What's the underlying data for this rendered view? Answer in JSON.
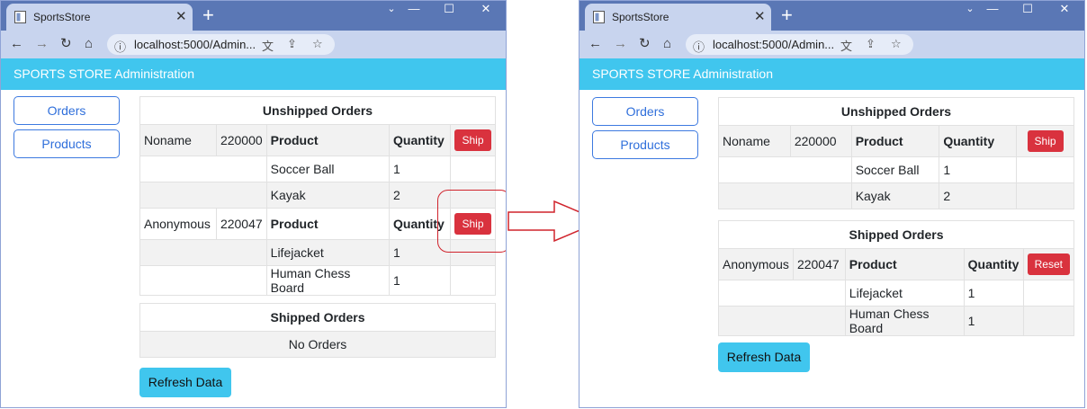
{
  "browser": {
    "tab_title": "SportsStore",
    "address": "localhost:5000/Admin...",
    "icons": [
      "back-arrow-icon",
      "forward-arrow-icon",
      "reload-icon",
      "home-icon",
      "info-icon",
      "translate-icon",
      "share-icon",
      "star-icon",
      "close-icon",
      "plus-icon",
      "minimize-icon",
      "maximize-icon"
    ]
  },
  "app": {
    "banner": "SPORTS STORE Administration",
    "nav": {
      "orders": "Orders",
      "products": "Products"
    },
    "refresh": "Refresh Data",
    "colors": {
      "banner": "#40c6ee",
      "danger": "#d9323e",
      "primary_outline": "#3d7ae0"
    }
  },
  "before": {
    "unshipped": {
      "title": "Unshipped Orders",
      "orders": [
        {
          "name": "Noname",
          "number": "220000",
          "product_header": "Product",
          "quantity_header": "Quantity",
          "action": "Ship",
          "lines": [
            {
              "product": "Soccer Ball",
              "quantity": "1"
            },
            {
              "product": "Kayak",
              "quantity": "2"
            }
          ]
        },
        {
          "name": "Anonymous",
          "number": "220047",
          "product_header": "Product",
          "quantity_header": "Quantity",
          "action": "Ship",
          "lines": [
            {
              "product": "Lifejacket",
              "quantity": "1"
            },
            {
              "product": "Human Chess Board",
              "quantity": "1"
            }
          ]
        }
      ]
    },
    "shipped": {
      "title": "Shipped Orders",
      "empty": "No Orders"
    }
  },
  "after": {
    "unshipped": {
      "title": "Unshipped Orders",
      "orders": [
        {
          "name": "Noname",
          "number": "220000",
          "product_header": "Product",
          "quantity_header": "Quantity",
          "action": "Ship",
          "lines": [
            {
              "product": "Soccer Ball",
              "quantity": "1"
            },
            {
              "product": "Kayak",
              "quantity": "2"
            }
          ]
        }
      ]
    },
    "shipped": {
      "title": "Shipped Orders",
      "orders": [
        {
          "name": "Anonymous",
          "number": "220047",
          "product_header": "Product",
          "quantity_header": "Quantity",
          "action": "Reset",
          "lines": [
            {
              "product": "Lifejacket",
              "quantity": "1"
            },
            {
              "product": "Human Chess Board",
              "quantity": "1"
            }
          ]
        }
      ]
    }
  }
}
